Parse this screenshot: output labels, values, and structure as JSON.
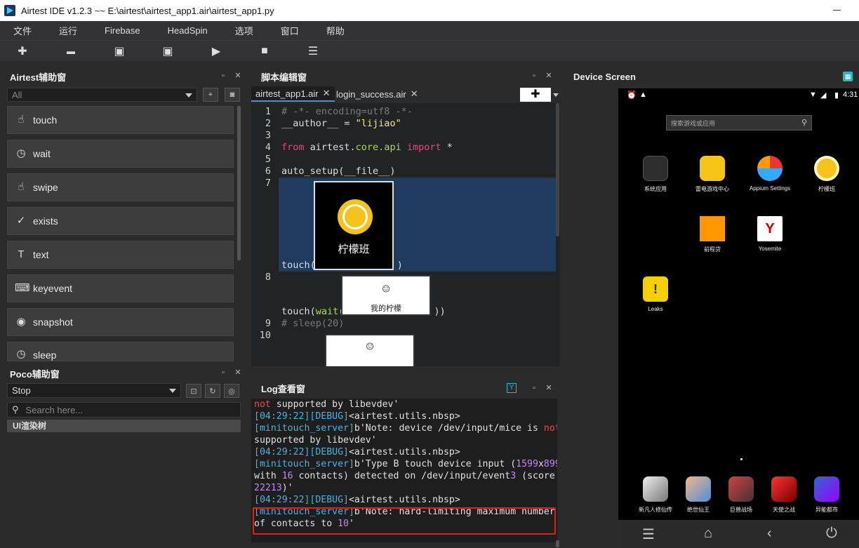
{
  "window": {
    "title": "Airtest IDE v1.2.3 ~~ E:\\airtest\\airtest_app1.air\\airtest_app1.py"
  },
  "menu": [
    "文件",
    "运行",
    "Firebase",
    "HeadSpin",
    "选项",
    "窗口",
    "帮助"
  ],
  "toolbar": {
    "icons": [
      "plus-icon",
      "folder-icon",
      "save-icon",
      "save-as-icon",
      "play-icon",
      "stop-icon",
      "log-icon"
    ],
    "glyphs": [
      "✚",
      "▬",
      "▣",
      "▣",
      "▶",
      "■",
      "☰"
    ]
  },
  "airtest_panel": {
    "title": "Airtest辅助窗",
    "filter_value": "All",
    "buttons": [
      {
        "label": "touch",
        "icon": "☝"
      },
      {
        "label": "wait",
        "icon": "◷"
      },
      {
        "label": "swipe",
        "icon": "☝"
      },
      {
        "label": "exists",
        "icon": "✓"
      },
      {
        "label": "text",
        "icon": "T"
      },
      {
        "label": "keyevent",
        "icon": "⌨"
      },
      {
        "label": "snapshot",
        "icon": "◉"
      },
      {
        "label": "sleep",
        "icon": "◷"
      }
    ]
  },
  "poco_panel": {
    "title": "Poco辅助窗",
    "mode_value": "Stop",
    "search_placeholder": "Search here...",
    "tree_root": "UI渲染树"
  },
  "editor": {
    "title": "脚本编辑窗",
    "tabs": [
      "airtest_app1.air",
      "login_success.air"
    ],
    "add_button": "✚",
    "line_numbers": [
      "1",
      "2",
      "3",
      "4",
      "5",
      "6",
      "7",
      "8",
      "9",
      "10"
    ],
    "lines": {
      "l1": "# -*- encoding=utf8 -*-",
      "l2_a": "__author__ = ",
      "l2_b": "\"lijiao\"",
      "l4_a": "from",
      "l4_b": " airtest.",
      "l4_c": "core.api",
      "l4_d": " import",
      "l4_e": " *",
      "l6": "auto_setup(__file__)",
      "l7_a": "touch(",
      "l7_b": ")",
      "l8_a": "touch(",
      "l8_b": "wait",
      "l8_c": "(",
      "l8_d": "))",
      "l9": "# sleep(20)"
    },
    "img1_label": "柠檬班",
    "img2_label": "我的柠檬"
  },
  "log_panel": {
    "title": "Log查看窗",
    "lines": [
      [
        [
          "r",
          "not"
        ],
        [
          "t",
          " supported by libevdev'"
        ]
      ],
      [
        [
          "c",
          "[04:29:22]"
        ],
        [
          "c",
          "[DEBUG]"
        ],
        [
          "t",
          "<airtest.utils.nbsp>"
        ]
      ],
      [
        [
          "c",
          "[minitouch_server]"
        ],
        [
          "t",
          "b'Note: device /dev/input/mice is "
        ],
        [
          "r",
          "not"
        ]
      ],
      [
        [
          "t",
          "supported by libevdev'"
        ]
      ],
      [
        [
          "c",
          "[04:29:22]"
        ],
        [
          "c",
          "[DEBUG]"
        ],
        [
          "t",
          "<airtest.utils.nbsp>"
        ]
      ],
      [
        [
          "c",
          "[minitouch_server]"
        ],
        [
          "t",
          "b'Type B touch device input ("
        ],
        [
          "p",
          "1599"
        ],
        [
          "t",
          "x"
        ],
        [
          "p",
          "899"
        ]
      ],
      [
        [
          "t",
          "with "
        ],
        [
          "p",
          "16"
        ],
        [
          "t",
          " contacts) detected on /dev/input/event"
        ],
        [
          "p",
          "3"
        ],
        [
          "t",
          " (score"
        ]
      ],
      [
        [
          "p",
          "22213"
        ],
        [
          "t",
          ")'"
        ]
      ],
      [
        [
          "c",
          "[04:29:22]"
        ],
        [
          "c",
          "[DEBUG]"
        ],
        [
          "t",
          "<airtest.utils.nbsp>"
        ]
      ],
      [
        [
          "c",
          "[minitouch_server]"
        ],
        [
          "t",
          "b'Note: hard-limiting maximum number"
        ]
      ],
      [
        [
          "t",
          "of contacts to "
        ],
        [
          "p",
          "10"
        ],
        [
          "t",
          "'"
        ]
      ]
    ]
  },
  "device_panel": {
    "title": "Device Screen",
    "status_time": "4:31",
    "search_placeholder": "搜索游戏或应用",
    "apps": [
      "系统应用",
      "雷电游戏中心",
      "Appium Settings",
      "柠檬班",
      "前程贷",
      "Yosemite",
      "Leaks"
    ],
    "dock": [
      "新凡人修仙传",
      "绝世仙王",
      "巨兽战场",
      "天使之战",
      "异能都市"
    ]
  }
}
